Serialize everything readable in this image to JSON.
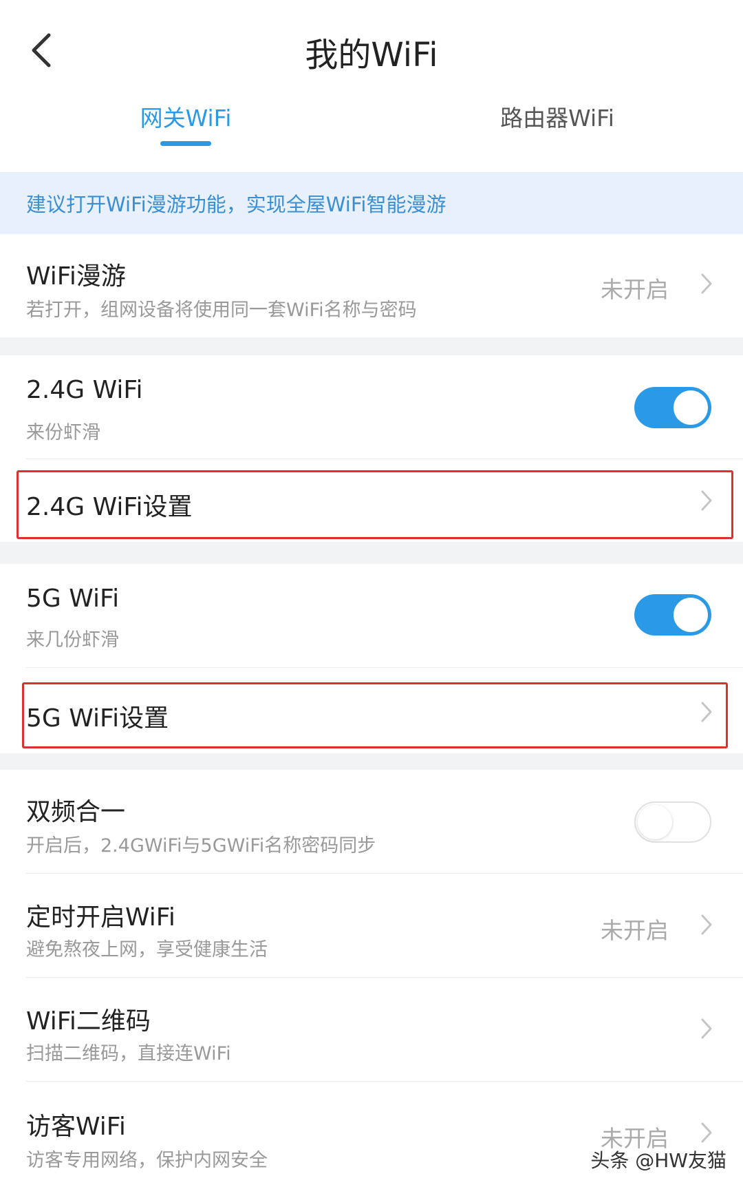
{
  "header": {
    "title": "我的WiFi",
    "back_icon": "chevron-left-icon"
  },
  "tabs": [
    {
      "label": "网关WiFi",
      "active": true
    },
    {
      "label": "路由器WiFi",
      "active": false
    }
  ],
  "notice": "建议打开WiFi漫游功能，实现全屋WiFi智能漫游",
  "rows": {
    "roaming": {
      "title": "WiFi漫游",
      "subtitle": "若打开，组网设备将使用同一套WiFi名称与密码",
      "status": "未开启"
    },
    "wifi24": {
      "title": "2.4G WiFi",
      "subtitle": "来份虾滑",
      "enabled": true
    },
    "wifi24_settings": {
      "title": "2.4G WiFi设置"
    },
    "wifi5": {
      "title": "5G WiFi",
      "subtitle": "来几份虾滑",
      "enabled": true
    },
    "wifi5_settings": {
      "title": "5G WiFi设置"
    },
    "dual_band": {
      "title": "双频合一",
      "subtitle": "开启后，2.4GWiFi与5GWiFi名称密码同步",
      "enabled": false
    },
    "schedule": {
      "title": "定时开启WiFi",
      "subtitle": "避免熬夜上网，享受健康生活",
      "status": "未开启"
    },
    "qrcode": {
      "title": "WiFi二维码",
      "subtitle": "扫描二维码，直接连WiFi"
    },
    "guest": {
      "title": "访客WiFi",
      "subtitle": "访客专用网络，保护内网安全",
      "status": "未开启"
    }
  },
  "watermark": "头条 @HW友猫",
  "colors": {
    "accent": "#2b9ae6",
    "highlight": "#d83131",
    "notice_bg": "#e8f1fb"
  }
}
